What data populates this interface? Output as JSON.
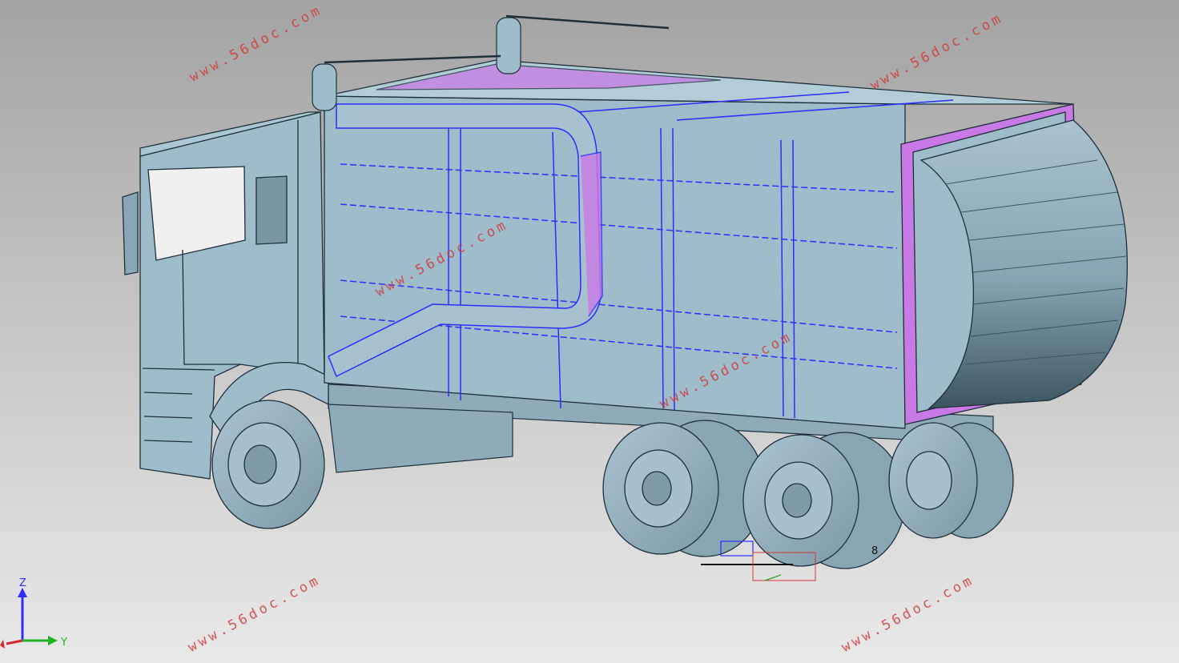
{
  "viewport": {
    "background_top": "#a3a3a3",
    "background_bottom": "#e9e9e9",
    "model_color": "#9fbccb",
    "edge_color": "#1f2f3a",
    "selection_color": "#2d2dff",
    "highlight_color": "#c879e6"
  },
  "watermarks": [
    "www.56doc.com",
    "www.56doc.com",
    "www.56doc.com",
    "www.56doc.com",
    "www.56doc.com",
    "www.56doc.com",
    "www.56doc.com"
  ],
  "triad": {
    "z_label": "Z",
    "y_label": "Y"
  },
  "dimension": {
    "value_text": "8"
  }
}
